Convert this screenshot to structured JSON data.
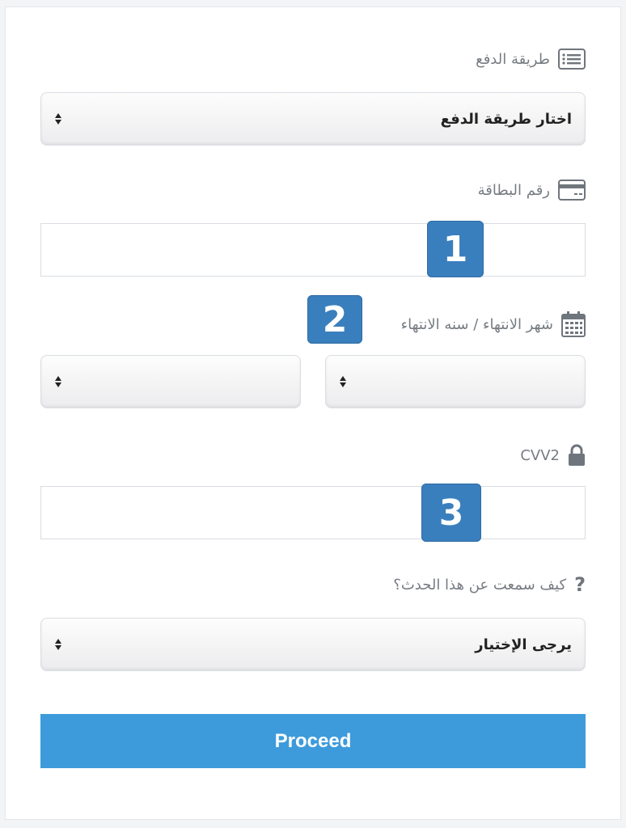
{
  "form": {
    "payment_method": {
      "label": "طريقة الدفع",
      "icon": "list-icon",
      "selected": "اختار طريقة الدفع"
    },
    "card_number": {
      "label": "رقم البطاقة",
      "icon": "credit-card-icon",
      "value": ""
    },
    "expiry": {
      "label": "شهر الانتهاء / سنه الانتهاء",
      "icon": "calendar-icon",
      "month_value": "",
      "year_value": ""
    },
    "cvv": {
      "label": "CVV2",
      "icon": "lock-icon",
      "value": ""
    },
    "how_heard": {
      "label": "كيف سمعت عن هذا الحدث؟",
      "icon": "question-icon",
      "selected": "يرجى الإختيار"
    },
    "proceed_label": "Proceed"
  },
  "badges": [
    "1",
    "2",
    "3"
  ],
  "colors": {
    "accent": "#3d9bdb",
    "badge": "#3a7fbd",
    "label_text": "#777c82"
  }
}
